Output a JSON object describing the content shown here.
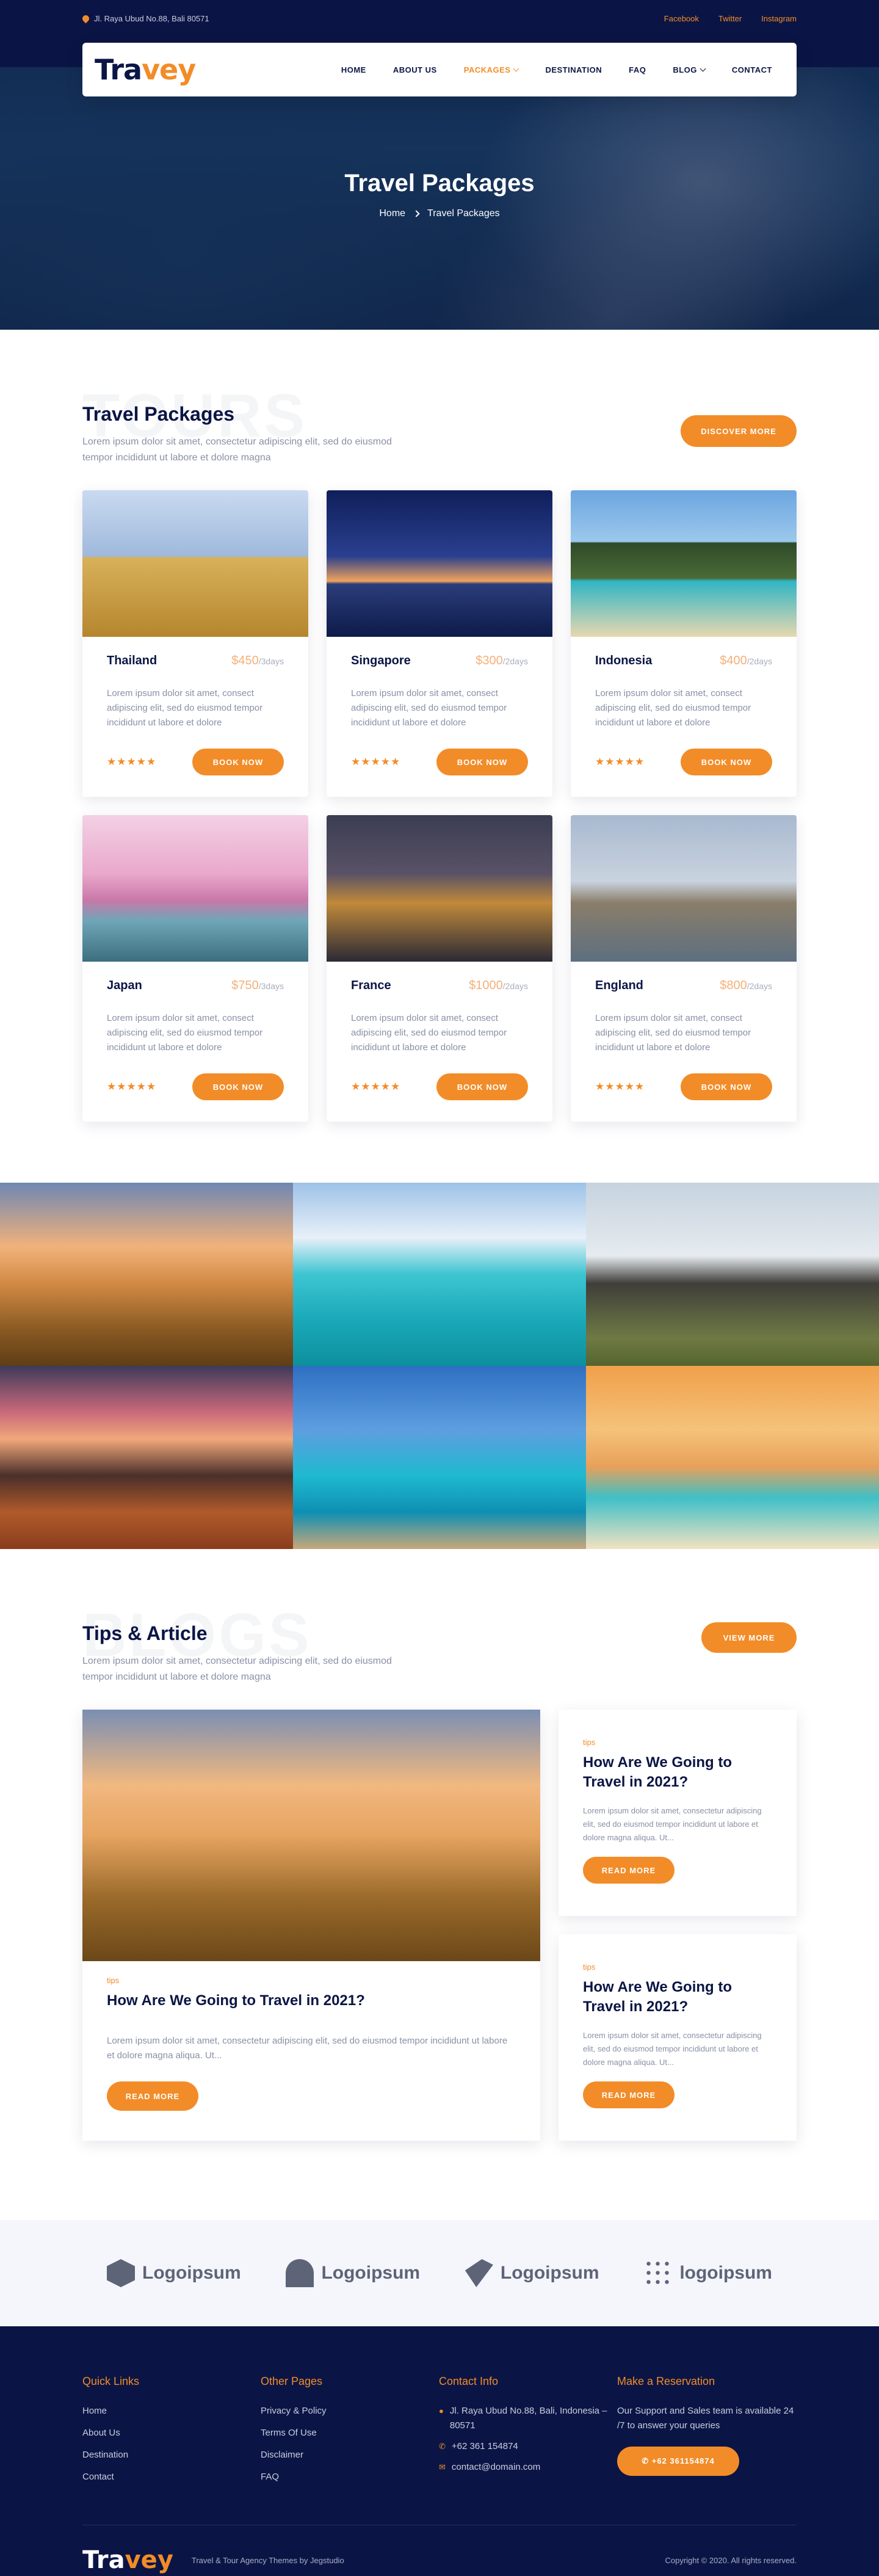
{
  "topbar": {
    "address": "Jl. Raya Ubud No.88, Bali 80571",
    "social": [
      "Facebook",
      "Twitter",
      "Instagram"
    ]
  },
  "nav": {
    "logo_part1": "Tra",
    "logo_part2": "vey",
    "items": [
      {
        "label": "HOME"
      },
      {
        "label": "ABOUT US"
      },
      {
        "label": "PACKAGES"
      },
      {
        "label": "DESTINATION"
      },
      {
        "label": "FAQ"
      },
      {
        "label": "BLOG"
      },
      {
        "label": "CONTACT"
      }
    ]
  },
  "hero": {
    "title": "Travel Packages",
    "breadcrumb_home": "Home",
    "breadcrumb_current": "Travel Packages"
  },
  "packages": {
    "ghost": "TOURS",
    "title": "Travel Packages",
    "subtitle": "Lorem ipsum dolor sit amet, consectetur adipiscing elit, sed do eiusmod tempor incididunt ut labore et dolore magna",
    "button": "DISCOVER MORE",
    "book_label": "BOOK NOW",
    "stars": "★★★★★",
    "items": [
      {
        "name": "Thailand",
        "price": "$450",
        "unit": "/3days",
        "text": "Lorem ipsum dolor sit amet, consect adipiscing elit, sed do eiusmod tempor incididunt ut labore et dolore"
      },
      {
        "name": "Singapore",
        "price": "$300",
        "unit": "/2days",
        "text": "Lorem ipsum dolor sit amet, consect adipiscing elit, sed do eiusmod tempor incididunt ut labore et dolore"
      },
      {
        "name": "Indonesia",
        "price": "$400",
        "unit": "/2days",
        "text": "Lorem ipsum dolor sit amet, consect adipiscing elit, sed do eiusmod tempor incididunt ut labore et dolore"
      },
      {
        "name": "Japan",
        "price": "$750",
        "unit": "/3days",
        "text": "Lorem ipsum dolor sit amet, consect adipiscing elit, sed do eiusmod tempor incididunt ut labore et dolore"
      },
      {
        "name": "France",
        "price": "$1000",
        "unit": "/2days",
        "text": "Lorem ipsum dolor sit amet, consect adipiscing elit, sed do eiusmod tempor incididunt ut labore et dolore"
      },
      {
        "name": "England",
        "price": "$800",
        "unit": "/2days",
        "text": "Lorem ipsum dolor sit amet, consect adipiscing elit, sed do eiusmod tempor incididunt ut labore et dolore"
      }
    ]
  },
  "blogs": {
    "ghost": "BLOGS",
    "title": "Tips & Article",
    "subtitle": "Lorem ipsum dolor sit amet, consectetur adipiscing elit, sed do eiusmod tempor incididunt ut labore et dolore magna",
    "button": "VIEW MORE",
    "read_label": "READ MORE",
    "main": {
      "tag": "tips",
      "title": "How Are We Going to Travel in 2021?",
      "text": "Lorem ipsum dolor sit amet, consectetur adipiscing elit, sed do eiusmod tempor incididunt ut labore et dolore magna aliqua. Ut..."
    },
    "side": [
      {
        "tag": "tips",
        "title": "How Are We Going to Travel in 2021?",
        "text": "Lorem ipsum dolor sit amet, consectetur adipiscing elit, sed do eiusmod tempor incididunt ut labore et dolore magna aliqua. Ut..."
      },
      {
        "tag": "tips",
        "title": "How Are We Going to Travel in 2021?",
        "text": "Lorem ipsum dolor sit amet, consectetur adipiscing elit, sed do eiusmod tempor incididunt ut labore et dolore magna aliqua. Ut..."
      }
    ]
  },
  "partners": [
    "Logoipsum",
    "Logoipsum",
    "Logoipsum",
    "logoipsum"
  ],
  "footer": {
    "quick_title": "Quick Links",
    "quick": [
      "Home",
      "About Us",
      "Destination",
      "Contact"
    ],
    "other_title": "Other Pages",
    "other": [
      "Privacy & Policy",
      "Terms Of Use",
      "Disclaimer",
      "FAQ"
    ],
    "contact_title": "Contact Info",
    "address": "Jl. Raya Ubud No.88, Bali, Indonesia – 80571",
    "phone": "+62 361 154874",
    "email": "contact@domain.com",
    "reserve_title": "Make a Reservation",
    "reserve_text": "Our Support and Sales team is available 24 /7 to answer your queries",
    "reserve_button": "+62 361154874",
    "tagline": "Travel & Tour Agency Themes by Jegstudio",
    "copyright": "Copyright © 2020. All rights reserved."
  },
  "colors": {
    "navy": "#0b1545",
    "accent": "#f28c28"
  }
}
